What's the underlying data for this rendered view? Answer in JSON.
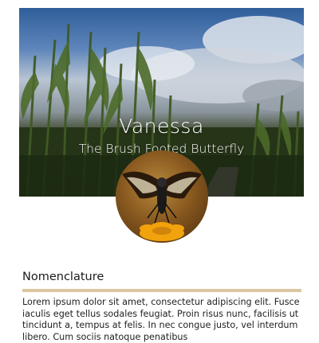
{
  "hero": {
    "title": "Vanessa",
    "subtitle": "The Brush Footed Butterfly",
    "image": "cornfield-sky-photo"
  },
  "avatar": {
    "image": "butterfly-on-flower-photo"
  },
  "section": {
    "title": "Nomenclature",
    "accent_color": "#dcc7a0",
    "body": "Lorem ipsum dolor sit amet, consectetur adipiscing elit. Fusce iaculis eget tellus sodales feugiat. Proin risus nunc, facilisis ut tincidunt a, tempus at felis. In nec congue justo, vel interdum libero. Cum sociis natoque penatibus"
  }
}
